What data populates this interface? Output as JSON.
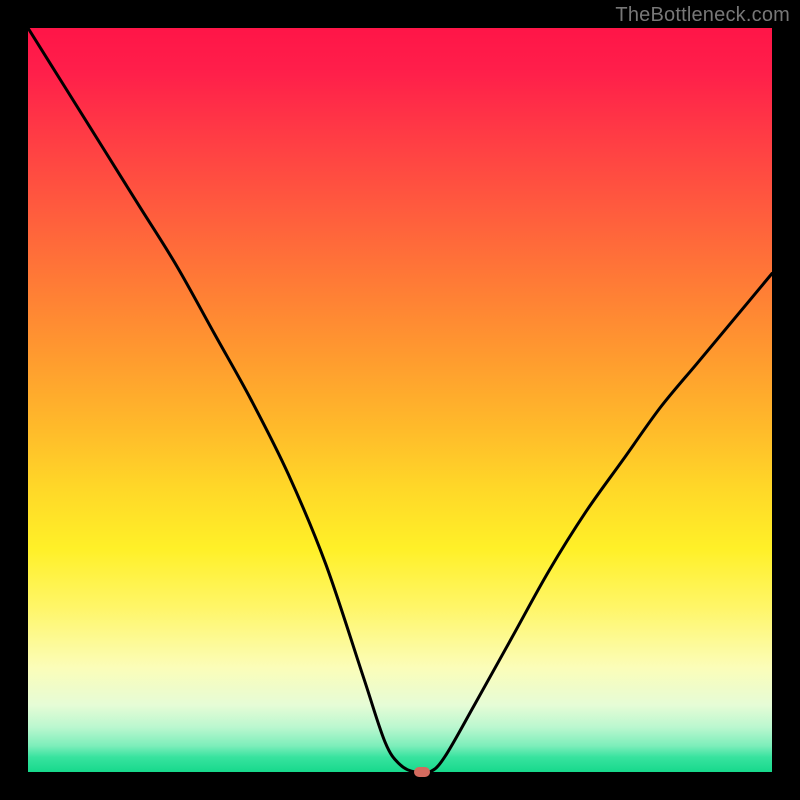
{
  "watermark": "TheBottleneck.com",
  "colors": {
    "frame": "#000000",
    "curve": "#000000",
    "minpoint": "#d36a5e",
    "gradient_stops": [
      "#ff1548",
      "#ff1f4a",
      "#ff3a45",
      "#ff5a3e",
      "#ff7a36",
      "#ff9a2f",
      "#ffbb2a",
      "#ffd828",
      "#fff028",
      "#fff669",
      "#fbfdb9",
      "#e6fcd6",
      "#baf7cf",
      "#7ceeba",
      "#38e39f",
      "#17d98c"
    ]
  },
  "chart_data": {
    "type": "line",
    "title": "",
    "xlabel": "",
    "ylabel": "",
    "xlim": [
      0,
      100
    ],
    "ylim": [
      0,
      100
    ],
    "grid": false,
    "legend": false,
    "series": [
      {
        "name": "bottleneck-curve",
        "x": [
          0,
          5,
          10,
          15,
          20,
          25,
          30,
          35,
          40,
          45,
          48,
          50,
          52,
          54,
          56,
          60,
          65,
          70,
          75,
          80,
          85,
          90,
          95,
          100
        ],
        "values": [
          100,
          92,
          84,
          76,
          68,
          59,
          50,
          40,
          28,
          13,
          4,
          1,
          0,
          0,
          2,
          9,
          18,
          27,
          35,
          42,
          49,
          55,
          61,
          67
        ]
      }
    ],
    "annotations": [
      {
        "name": "minimum-marker",
        "x": 53,
        "y": 0
      }
    ]
  }
}
